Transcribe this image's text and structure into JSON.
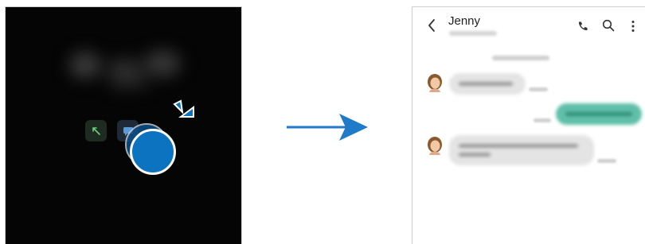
{
  "left_screen": {
    "answer_button_icon": "phone-answer-icon",
    "reply_button_icon": "message-icon",
    "drag_handle_icon": "drag-circle-icon"
  },
  "arrow_icon": "right-arrow-icon",
  "chat": {
    "contact_name": "Jenny",
    "header_icons": [
      "back-icon",
      "phone-icon",
      "search-icon",
      "more-options-icon"
    ]
  },
  "colors": {
    "accent": "#0b73bf",
    "sent_bubble": "#5fbfa8",
    "received_bubble": "#e4e4e4"
  }
}
